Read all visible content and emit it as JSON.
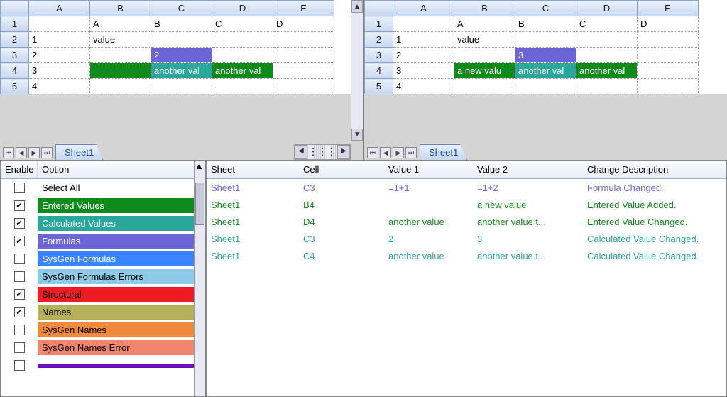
{
  "left_sheet": {
    "tab": "Sheet1",
    "columns": [
      "A",
      "B",
      "C",
      "D",
      "E"
    ],
    "row_numbers": [
      "1",
      "2",
      "3",
      "4",
      "5"
    ],
    "cells": {
      "r1": [
        "",
        "A",
        "B",
        "C",
        "D"
      ],
      "r2": [
        "1",
        "value",
        "",
        "",
        ""
      ],
      "r3": [
        "2",
        "",
        "2",
        "",
        ""
      ],
      "r4": [
        "3",
        "",
        "another val",
        "another val",
        ""
      ],
      "r5": [
        "4",
        "",
        "",
        "",
        ""
      ]
    }
  },
  "right_sheet": {
    "tab": "Sheet1",
    "columns": [
      "A",
      "B",
      "C",
      "D",
      "E"
    ],
    "row_numbers": [
      "1",
      "2",
      "3",
      "4",
      "5"
    ],
    "cells": {
      "r1": [
        "",
        "A",
        "B",
        "C",
        "D"
      ],
      "r2": [
        "1",
        "value",
        "",
        "",
        ""
      ],
      "r3": [
        "2",
        "",
        "3",
        "",
        ""
      ],
      "r4": [
        "3",
        "a new valu",
        "another val",
        "another val",
        ""
      ],
      "r5": [
        "4",
        "",
        "",
        "",
        ""
      ]
    }
  },
  "options": {
    "headers": {
      "enable": "Enable",
      "option": "Option"
    },
    "items": [
      {
        "label": "Select All",
        "checked": false,
        "bg": "bg-white",
        "fg": "fg-black"
      },
      {
        "label": "Entered Values",
        "checked": true,
        "bg": "bg-green",
        "fg": ""
      },
      {
        "label": "Calculated Values",
        "checked": true,
        "bg": "bg-teal",
        "fg": ""
      },
      {
        "label": "Formulas",
        "checked": true,
        "bg": "bg-purple",
        "fg": ""
      },
      {
        "label": "SysGen Formulas",
        "checked": false,
        "bg": "bg-blue",
        "fg": ""
      },
      {
        "label": "SysGen Formulas Errors",
        "checked": false,
        "bg": "bg-sky",
        "fg": "fg-black"
      },
      {
        "label": "Structural",
        "checked": true,
        "bg": "bg-red",
        "fg": "fg-black"
      },
      {
        "label": "Names",
        "checked": true,
        "bg": "bg-olive",
        "fg": "fg-black"
      },
      {
        "label": "SysGen Names",
        "checked": false,
        "bg": "bg-orange",
        "fg": "fg-black"
      },
      {
        "label": "SysGen Names Error",
        "checked": false,
        "bg": "bg-salmon",
        "fg": "fg-black"
      },
      {
        "label": "",
        "checked": false,
        "bg": "bg-violet",
        "fg": ""
      }
    ]
  },
  "changes": {
    "headers": {
      "sheet": "Sheet",
      "cell": "Cell",
      "v1": "Value 1",
      "v2": "Value 2",
      "desc": "Change Description"
    },
    "rows": [
      {
        "type": "formula",
        "sheet": "Sheet1",
        "cell": "C3",
        "v1": "=1+1",
        "v2": "=1+2",
        "desc": "Formula Changed."
      },
      {
        "type": "entered",
        "sheet": "Sheet1",
        "cell": "B4",
        "v1": "",
        "v2": "a new value",
        "desc": "Entered Value Added."
      },
      {
        "type": "entered",
        "sheet": "Sheet1",
        "cell": "D4",
        "v1": "another value",
        "v2": "another value t...",
        "desc": "Entered Value Changed."
      },
      {
        "type": "calc",
        "sheet": "Sheet1",
        "cell": "C3",
        "v1": "2",
        "v2": "3",
        "desc": "Calculated Value Changed."
      },
      {
        "type": "calc",
        "sheet": "Sheet1",
        "cell": "C4",
        "v1": "another value",
        "v2": "another value t...",
        "desc": "Calculated Value Changed."
      }
    ]
  }
}
